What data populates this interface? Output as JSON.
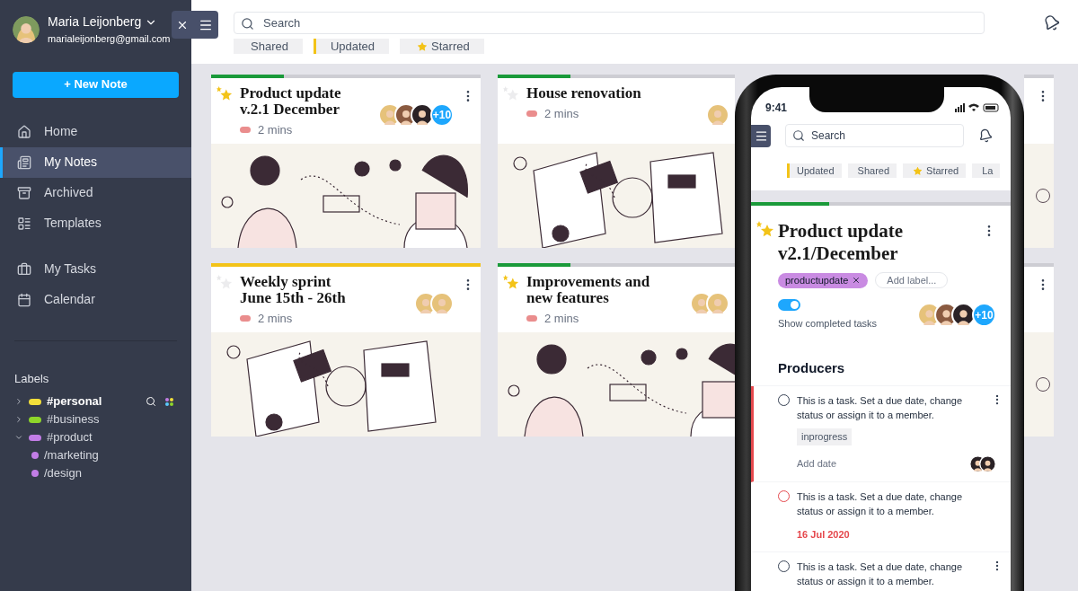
{
  "user": {
    "name": "Maria Leijonberg",
    "email": "marialeijonberg@gmail.com"
  },
  "new_note": "+ New Note",
  "nav_groups": [
    {
      "items": [
        {
          "label": "Home",
          "kind": "home",
          "selected": false
        },
        {
          "label": "My Notes",
          "kind": "notes",
          "selected": true
        },
        {
          "label": "Archived",
          "kind": "archive",
          "selected": false
        },
        {
          "label": "Templates",
          "kind": "templates",
          "selected": false
        }
      ]
    },
    {
      "items": [
        {
          "label": "My Tasks",
          "kind": "tasks",
          "selected": false
        },
        {
          "label": "Calendar",
          "kind": "calendar",
          "selected": false
        }
      ]
    }
  ],
  "labels": {
    "title": "Labels",
    "items": [
      {
        "name": "#personal",
        "color": "#f2de3a",
        "selected": true,
        "expanded": false
      },
      {
        "name": "#business",
        "color": "#8ed62a",
        "selected": false,
        "expanded": false
      },
      {
        "name": "#product",
        "color": "#c27de6",
        "selected": false,
        "expanded": true,
        "children": [
          {
            "name": "/marketing",
            "color": "#c27de6",
            "selected": false
          },
          {
            "name": "/design",
            "color": "#c27de6",
            "selected": false
          }
        ]
      }
    ]
  },
  "search": {
    "placeholder": "Search"
  },
  "filters": [
    {
      "label": "Shared",
      "kind": "text",
      "selected": false
    },
    {
      "label": "Updated",
      "kind": "text",
      "selected": true
    },
    {
      "label": "Starred",
      "kind": "star",
      "selected": false
    }
  ],
  "cards": [
    {
      "kind": "note",
      "title": "Product update\nv.2.1 December",
      "starred": true,
      "duration": "2 mins",
      "progress": {
        "level": 0.27,
        "color": "#1a9a3a"
      },
      "members": [
        {
          "color": "#e6c27a"
        },
        {
          "color": "#8a5a40"
        },
        {
          "color": "#2a2226"
        }
      ],
      "more": "+10"
    },
    {
      "kind": "note",
      "title": "House renovation",
      "starred": false,
      "duration": "2 mins",
      "progress": {
        "level": 0.27,
        "color": "#1a9a3a"
      },
      "members": [
        {
          "color": "#e6c27a"
        }
      ]
    },
    {
      "kind": "covered"
    },
    {
      "kind": "note",
      "title": "Weekly sprint\nJune 15th - 26th",
      "starred": false,
      "duration": "2 mins",
      "progress": {
        "level": 1,
        "color": "#f3c318"
      },
      "members": [
        {
          "color": "#e6c27a"
        },
        {
          "color": "#e6c27a"
        }
      ]
    },
    {
      "kind": "note",
      "title": "Improvements and\nnew features",
      "starred": true,
      "duration": "2 mins",
      "progress": {
        "level": 0.27,
        "color": "#1a9a3a"
      },
      "members": [
        {
          "color": "#e6c27a"
        },
        {
          "color": "#e6c27a"
        }
      ]
    },
    {
      "kind": "covered"
    }
  ],
  "phone": {
    "time": "9:41",
    "search": {
      "placeholder": "Search"
    },
    "filters": [
      {
        "label": "Updated",
        "kind": "text",
        "selected": true
      },
      {
        "label": "Shared",
        "kind": "text",
        "selected": false
      },
      {
        "label": "Starred",
        "kind": "star",
        "selected": false
      },
      {
        "label": "La",
        "kind": "text",
        "selected": false
      }
    ],
    "note": {
      "title": "Product update\nv2.1/December",
      "starred": true,
      "progress": {
        "level": 0.3,
        "color": "#1a9a3a"
      },
      "labels": [
        {
          "name": "productupdate",
          "color": "#c98be2"
        }
      ],
      "add_label": "Add label...",
      "show_completed": {
        "label": "Show completed tasks",
        "on": true
      },
      "members": [
        {
          "color": "#e6c27a"
        },
        {
          "color": "#8a5a40"
        },
        {
          "color": "#2a2226"
        }
      ],
      "more": "+10",
      "section": "Producers",
      "tasks": [
        {
          "text": "This is a task. Set a due date, change status or assign it to a member.",
          "selected": true,
          "overdue": false,
          "menu": true,
          "tag": "inprogress",
          "date": "Add date",
          "members": [
            {
              "color": "#2a2226"
            },
            {
              "color": "#2a2226"
            }
          ]
        },
        {
          "text": "This is a task. Set a due date, change status or assign it to a member.",
          "selected": false,
          "overdue": true,
          "menu": false,
          "date": "16 Jul 2020"
        },
        {
          "text": "This is a task. Set a due date, change status or assign it to a member.",
          "selected": false,
          "overdue": false,
          "menu": true
        }
      ]
    }
  }
}
